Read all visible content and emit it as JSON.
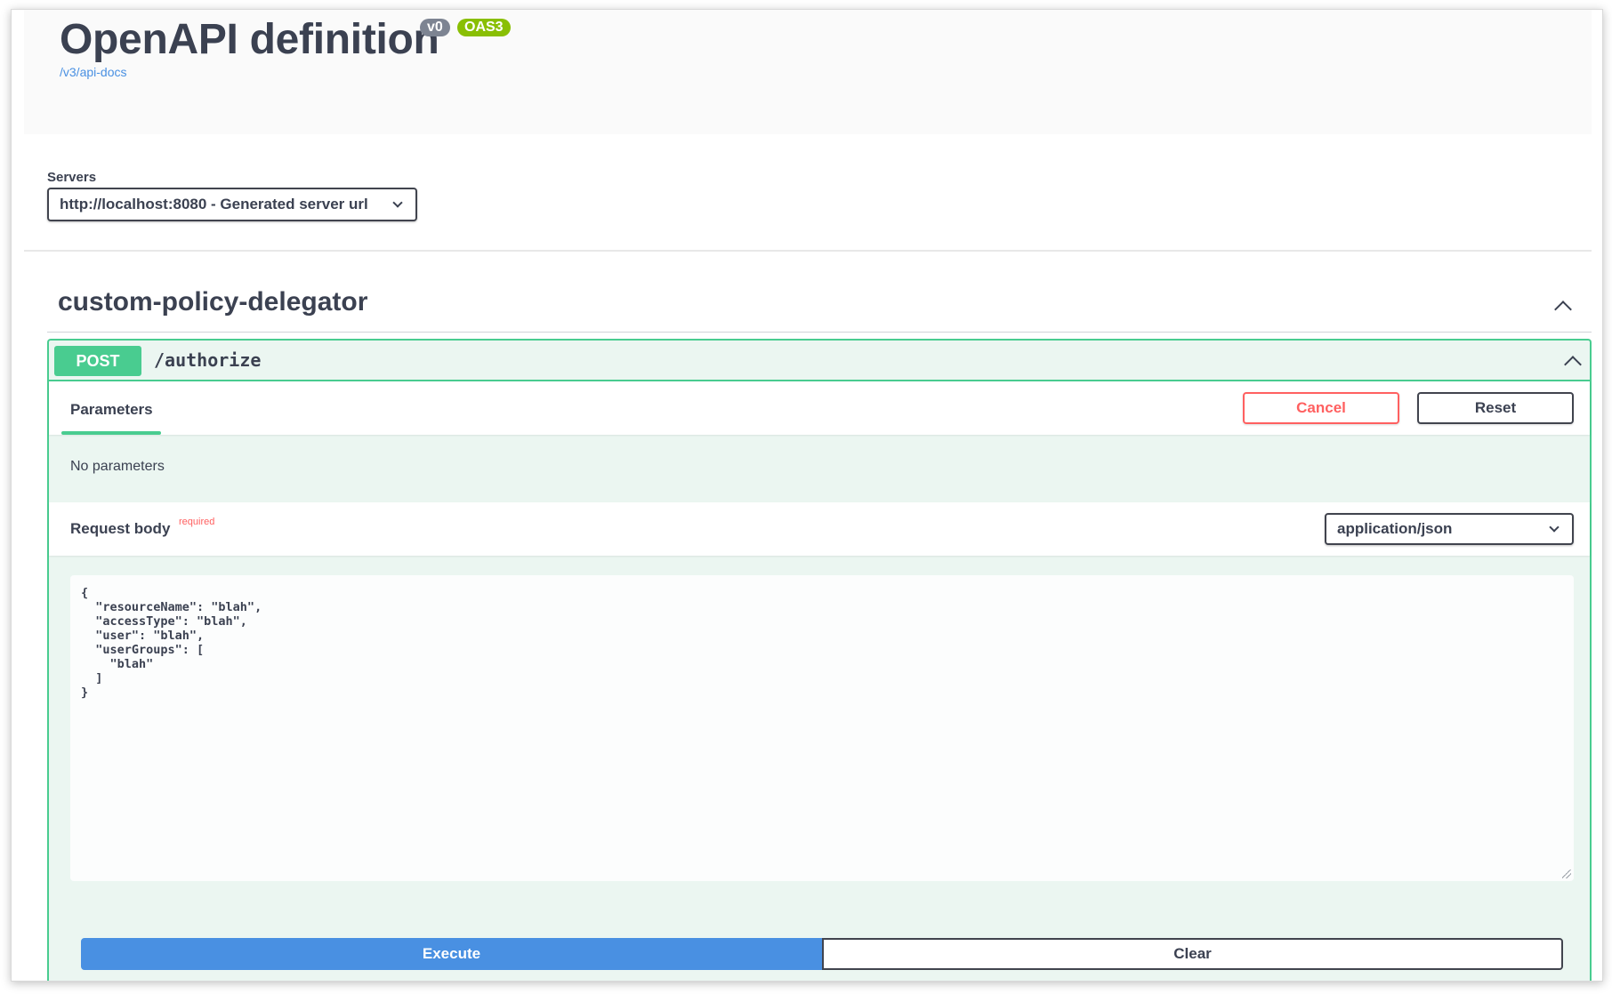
{
  "info": {
    "title": "OpenAPI definition",
    "version_badge": "v0",
    "oas_badge": "OAS3",
    "docs_link": "/v3/api-docs"
  },
  "servers": {
    "label": "Servers",
    "selected": "http://localhost:8080 - Generated server url"
  },
  "tag": {
    "name": "custom-policy-delegator"
  },
  "operation": {
    "method": "POST",
    "path": "/authorize",
    "tab_parameters": "Parameters",
    "cancel_label": "Cancel",
    "reset_label": "Reset",
    "no_parameters": "No parameters",
    "request_body_title": "Request body",
    "required_label": "required",
    "content_type": "application/json",
    "body_text": "{\n  \"resourceName\": \"blah\",\n  \"accessType\": \"blah\",\n  \"user\": \"blah\",\n  \"userGroups\": [\n    \"blah\"\n  ]\n}",
    "execute_label": "Execute",
    "clear_label": "Clear"
  },
  "colors": {
    "post": "#49cc90",
    "execute": "#4990e2",
    "cancel": "#ff6060",
    "link": "#4990e2"
  }
}
